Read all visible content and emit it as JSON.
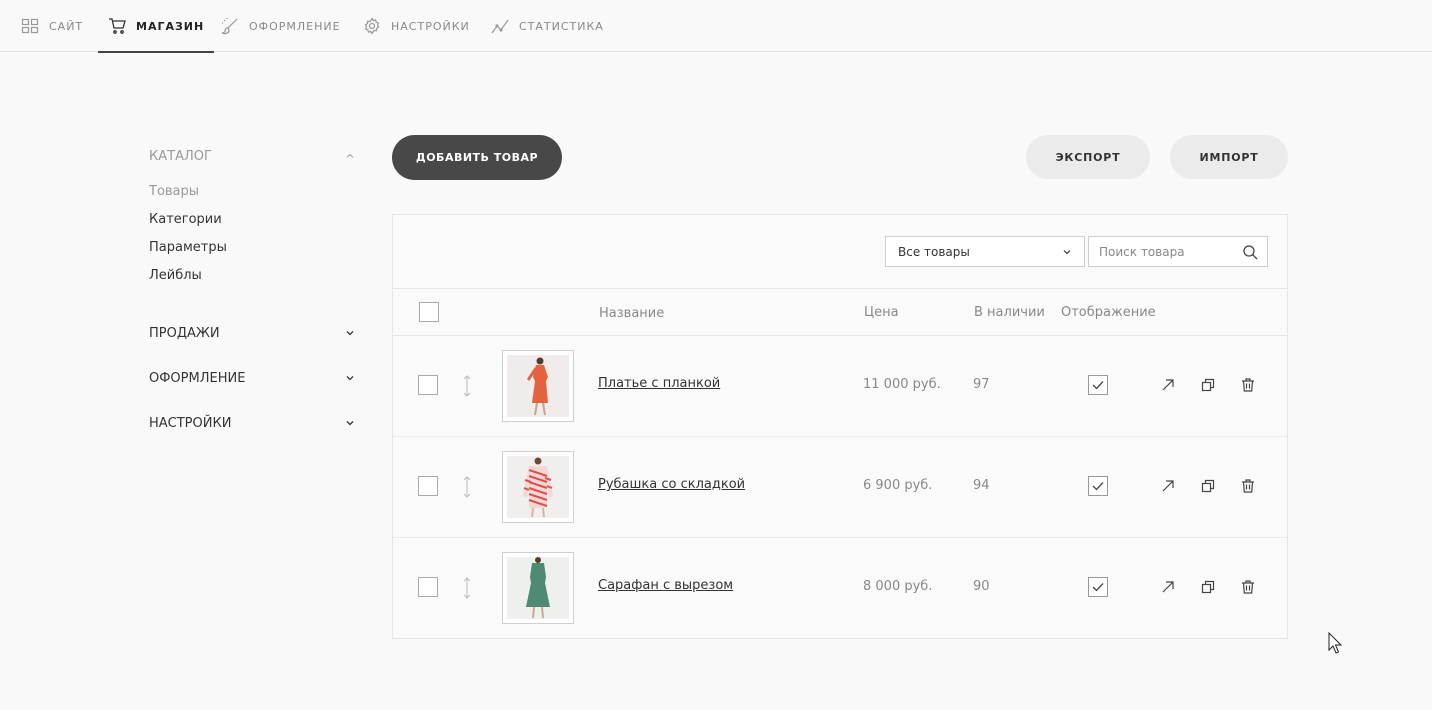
{
  "topnav": {
    "items": [
      {
        "label": "САЙТ",
        "icon": "grid-icon",
        "active": false
      },
      {
        "label": "МАГАЗИН",
        "icon": "cart-icon",
        "active": true
      },
      {
        "label": "ОФОРМЛЕНИЕ",
        "icon": "brush-icon",
        "active": false
      },
      {
        "label": "НАСТРОЙКИ",
        "icon": "gear-icon",
        "active": false
      },
      {
        "label": "СТАТИСТИКА",
        "icon": "chart-line-icon",
        "active": false
      }
    ]
  },
  "sidebar": {
    "catalog": {
      "title": "КАТАЛОГ",
      "expanded": true,
      "items": [
        "Товары",
        "Категории",
        "Параметры",
        "Лейблы"
      ],
      "active_item": "Товары"
    },
    "sections": [
      "ПРОДАЖИ",
      "ОФОРМЛЕНИЕ",
      "НАСТРОЙКИ"
    ]
  },
  "toolbar": {
    "add_label": "ДОБАВИТЬ ТОВАР",
    "export_label": "ЭКСПОРТ",
    "import_label": "ИМПОРТ"
  },
  "filters": {
    "select_value": "Все товары",
    "search_placeholder": "Поиск товара"
  },
  "table": {
    "columns": {
      "name": "Название",
      "price": "Цена",
      "stock": "В наличии",
      "display": "Отображение"
    },
    "rows": [
      {
        "name": "Платье с планкой",
        "price": "11 000 руб.",
        "stock": "97",
        "displayed": true,
        "thumb_color": "#e3633f"
      },
      {
        "name": "Рубашка со складкой",
        "price": "6 900 руб.",
        "stock": "94",
        "displayed": true,
        "thumb_color": "#d9524e"
      },
      {
        "name": "Сарафан с вырезом",
        "price": "8 000 руб.",
        "stock": "90",
        "displayed": true,
        "thumb_color": "#4e8a74"
      }
    ]
  },
  "colors": {
    "accent_dark": "#484848",
    "button_light": "#ebebeb",
    "muted_text": "#888888"
  }
}
